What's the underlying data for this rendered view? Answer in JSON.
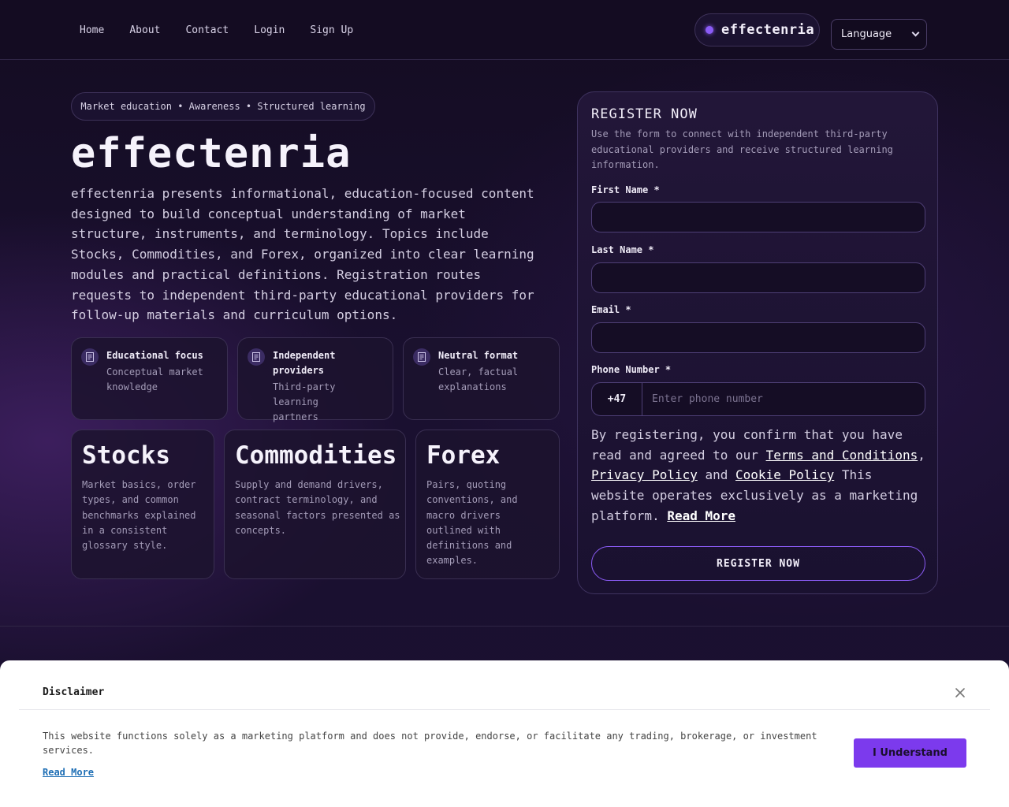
{
  "header": {
    "nav": [
      "Home",
      "About",
      "Contact",
      "Login",
      "Sign Up"
    ],
    "brand": "effectenria",
    "language_label": "Language"
  },
  "hero": {
    "tagline": "Market education • Awareness • Structured learning",
    "title": "effectenria",
    "description": "effectenria presents informational, education-focused content designed to build conceptual understanding of market structure, instruments, and terminology. Topics include Stocks, Commodities, and Forex, organized into clear learning modules and practical definitions. Registration routes requests to independent third-party educational providers for follow-up materials and curriculum options."
  },
  "features": [
    {
      "title": "Educational focus",
      "desc": "Conceptual market knowledge",
      "icon": "document-icon"
    },
    {
      "title": "Independent providers",
      "desc": "Third-party learning partners",
      "icon": "document-icon"
    },
    {
      "title": "Neutral format",
      "desc": "Clear, factual explanations",
      "icon": "document-icon"
    }
  ],
  "topics": [
    {
      "title": "Stocks",
      "desc": "Market basics, order types, and common benchmarks explained in a consistent glossary style."
    },
    {
      "title": "Commodities",
      "desc": "Supply and demand drivers, contract terminology, and seasonal factors presented as concepts."
    },
    {
      "title": "Forex",
      "desc": "Pairs, quoting conventions, and macro drivers outlined with definitions and examples."
    }
  ],
  "register": {
    "title": "REGISTER NOW",
    "subtitle": "Use the form to connect with independent third-party educational providers and receive structured learning information.",
    "first_name_label": "First Name *",
    "last_name_label": "Last Name *",
    "email_label": "Email *",
    "phone_label": "Phone Number *",
    "phone_code": "+47",
    "phone_placeholder": "Enter phone number",
    "consent_prefix": "By registering, you confirm that you have read and agreed to our ",
    "terms_link": "Terms and Conditions",
    "privacy_link": "Privacy Policy",
    "and_text": " and ",
    "cookie_link": "Cookie Policy",
    "consent_suffix": " This website operates exclusively as a marketing platform. ",
    "read_more": "Read More",
    "button": "REGISTER NOW"
  },
  "disclaimer": {
    "title": "Disclaimer",
    "text": "This website functions solely as a marketing platform and does not provide, endorse, or facilitate any trading, brokerage, or investment services.",
    "read_more": "Read More",
    "button": "I Understand"
  },
  "colors": {
    "background": "#150d24",
    "accent": "#8b5cf6",
    "button_primary": "#7c3aed",
    "card_border": "#3f3360"
  }
}
